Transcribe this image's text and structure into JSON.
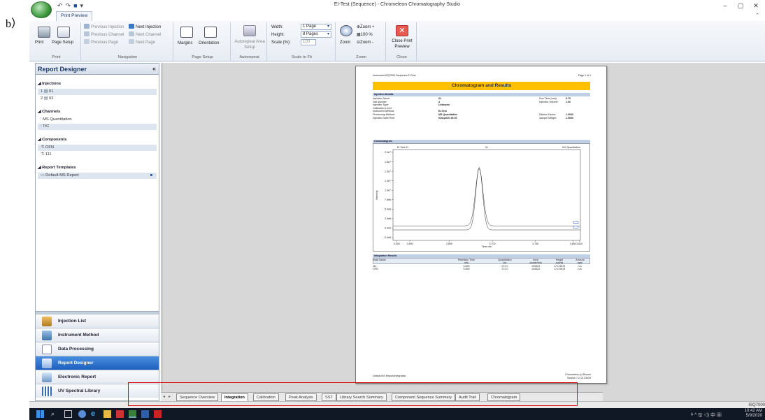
{
  "figure_label": "b）",
  "window": {
    "title": "EI-Test (Sequence) - Chromeleon Chromatography Studio",
    "controls": [
      "–",
      "▢",
      "✕"
    ]
  },
  "ribbon": {
    "tab": "Print Preview",
    "groups": {
      "print": {
        "label": "Print",
        "print": "Print",
        "page_setup": "Page Setup"
      },
      "navigation": {
        "label": "Navigation",
        "prev_injection": "Previous Injection",
        "next_injection": "Next Injection",
        "prev_channel": "Previous Channel",
        "next_channel": "Next Channel",
        "prev_page": "Previous Page",
        "next_page": "Next Page"
      },
      "page_setup": {
        "label": "Page Setup",
        "margins": "Margins",
        "orientation": "Orientation"
      },
      "autorepeat": {
        "label": "Autorepeat",
        "setup": "Autorepeat Area Setup"
      },
      "scale_to_fit": {
        "label": "Scale to Fit",
        "width_label": "Width:",
        "width_value": "1 Page",
        "height_label": "Height:",
        "height_value": "8 Pages",
        "scale_label": "Scale (%):",
        "scale_value": "100"
      },
      "zoom": {
        "label": "Zoom",
        "zoom": "Zoom",
        "zoom_plus": "Zoom +",
        "zoom_100": "100 %",
        "zoom_minus": "Zoom -"
      },
      "close": {
        "label": "Close",
        "close_preview": "Close Print Preview"
      }
    }
  },
  "left_panel": {
    "title": "Report Designer",
    "sections": {
      "injections": {
        "label": "Injections",
        "items": [
          "01",
          "02"
        ],
        "numbers": [
          "1",
          "2"
        ]
      },
      "channels": {
        "label": "Channels",
        "items": [
          "MS Quantitation",
          "TIC"
        ]
      },
      "components": {
        "label": "Components",
        "items": [
          "OFN",
          "111"
        ]
      },
      "report_templates": {
        "label": "Report Templates",
        "items": [
          "Default MS Report"
        ]
      }
    },
    "nav": [
      "Injection List",
      "Instrument Method",
      "Data Processing",
      "Report Designer",
      "Electronic Report",
      "UV Spectral Library"
    ]
  },
  "report": {
    "header_left": "Instrument:ISQ7000 Sequence:EI-Test",
    "header_right": "Page 1 of 1",
    "title": "Chromatogram and Results",
    "injection_details": {
      "label": "Injection Details",
      "rows": [
        [
          "Injection Name:",
          "01",
          "Run Time (min):",
          "5.79"
        ],
        [
          "Vial Number:",
          "3",
          "Injection Volume:",
          "1.00"
        ],
        [
          "Injection Type:",
          "Unknown",
          "",
          ""
        ],
        [
          "Calibration Level:",
          "",
          "",
          ""
        ],
        [
          "Instrument Method:",
          "EI-Test",
          "",
          ""
        ],
        [
          "Processing Method:",
          "MS Quantitative",
          "Dilution Factor:",
          "1.0000"
        ],
        [
          "Injection Date/Time:",
          "02/Apr/20 15:35",
          "Sample Weight:",
          "1.0000"
        ]
      ]
    },
    "chromatogram": {
      "label": "Chromatogram",
      "legend_left": "EI-Test #1",
      "legend_mid": "01",
      "legend_right": "MS Quantitation",
      "y_ticks": [
        "2.0e7",
        "1.8e7",
        "1.5e7",
        "1.3e7",
        "1.0e7",
        "7.5e6",
        "5.0e6",
        "2.5e6",
        "0.0e0",
        "-2.0e6"
      ],
      "x_ticks": [
        "3.500",
        "3.600",
        "3.650",
        "3.700",
        "3.750",
        "3.800",
        "3.810"
      ],
      "xlabel": "Time min",
      "ylabel": "Intensity"
    },
    "integration": {
      "label": "Integration Results",
      "headers": [
        "Peak Name",
        "Retention Time",
        "Quantitation",
        "Area",
        "Height",
        "Amount"
      ],
      "units": [
        "",
        "min",
        "ion",
        "counts*min",
        "counts",
        "ppm"
      ],
      "rows": [
        [
          "111",
          "3.690",
          "272.0",
          "193523",
          "17174578",
          "n.a."
        ],
        [
          "OFN",
          "3.690",
          "272.0",
          "193523",
          "17174578",
          "n.a."
        ]
      ]
    },
    "footer_left": "Default MS Report/Integration",
    "footer_right": "Chromeleon (c) Dionex Version 7.2.10.23925"
  },
  "bottom_tabs": [
    "Sequence Overview",
    "Integration",
    "Calibration",
    "Peak Analysis",
    "SST",
    "Library Search Summary",
    "Component Sequence Summary",
    "Audit Trail",
    "Chromatogram"
  ],
  "active_bottom_tab": "Integration",
  "status": {
    "right": "ISQ7000"
  },
  "taskbar": {
    "time": "10:42 AM",
    "date": "5/9/2020",
    "tray": "ᴬ ^ 🖫 ◁) 中 ▦"
  }
}
